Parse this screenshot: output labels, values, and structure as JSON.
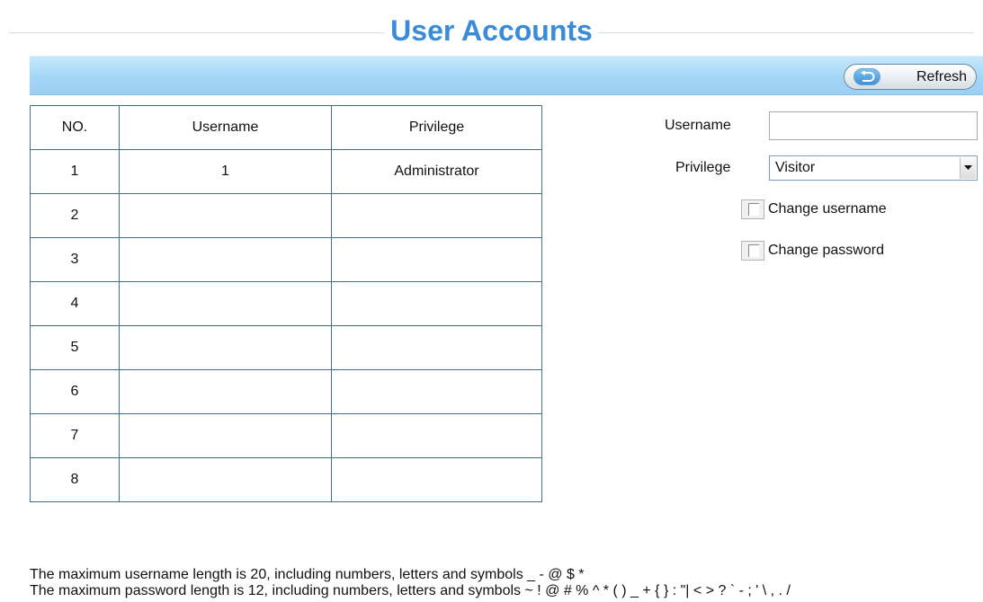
{
  "header": {
    "title": "User Accounts"
  },
  "toolbar": {
    "refresh_label": "Refresh"
  },
  "table": {
    "headers": [
      "NO.",
      "Username",
      "Privilege"
    ],
    "rows": [
      [
        "1",
        "1",
        "Administrator"
      ],
      [
        "2",
        "",
        ""
      ],
      [
        "3",
        "",
        ""
      ],
      [
        "4",
        "",
        ""
      ],
      [
        "5",
        "",
        ""
      ],
      [
        "6",
        "",
        ""
      ],
      [
        "7",
        "",
        ""
      ],
      [
        "8",
        "",
        ""
      ]
    ]
  },
  "form": {
    "username_label": "Username",
    "username_value": "",
    "privilege_label": "Privilege",
    "privilege_value": "Visitor",
    "change_username_label": "Change username",
    "change_username_checked": false,
    "change_password_label": "Change password",
    "change_password_checked": false
  },
  "notes": {
    "username_rule": "The maximum username length is 20, including numbers, letters and symbols _ - @ $ *",
    "password_rule": "The maximum password length is 12, including numbers, letters and symbols ~ ! @ # % ^ * ( ) _ + { } : \"| < > ? ` - ; ' \\ , . /"
  },
  "icons": {
    "refresh": "refresh-arrow-icon",
    "dropdown": "chevron-down-icon"
  },
  "colors": {
    "title": "#3a8bd8",
    "toolbar": "#a4d6f7",
    "table_border": "#3f6e8f"
  }
}
